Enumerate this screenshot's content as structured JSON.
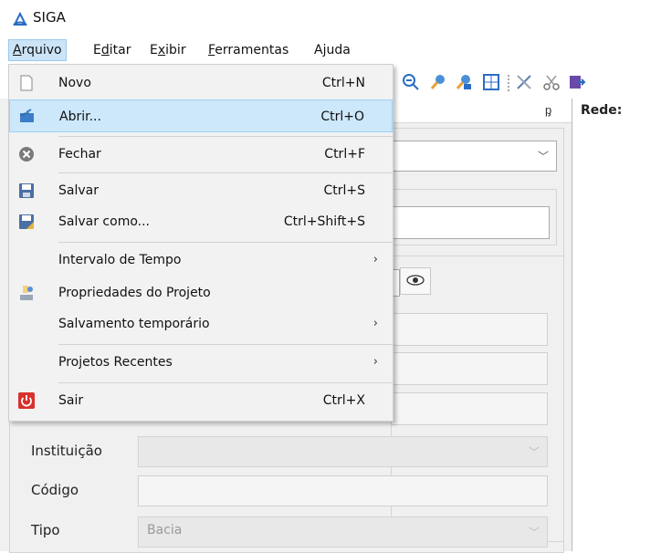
{
  "app": {
    "title": "SIGA"
  },
  "menubar": {
    "items": [
      {
        "label": "Arquivo",
        "key": "A",
        "rest": "rquivo"
      },
      {
        "label": "Editar",
        "key": "d",
        "pre": "E",
        "rest": "itar"
      },
      {
        "label": "Exibir",
        "key": "x",
        "pre": "E",
        "rest": "ibir"
      },
      {
        "label": "Ferramentas",
        "key": "F",
        "rest": "erramentas"
      },
      {
        "label": "Ajuda",
        "key": "j",
        "pre": "A",
        "rest": "uda"
      }
    ]
  },
  "panel": {
    "rede_label": "Rede:"
  },
  "form": {
    "instituicao_label": "Instituição",
    "codigo_label": "Código",
    "tipo_label": "Tipo",
    "tipo_value": "Bacia"
  },
  "file_menu": {
    "items": [
      {
        "label": "Novo",
        "shortcut": "Ctrl+N"
      },
      {
        "label": "Abrir...",
        "shortcut": "Ctrl+O"
      },
      {
        "label": "Fechar",
        "shortcut": "Ctrl+F"
      },
      {
        "label": "Salvar",
        "shortcut": "Ctrl+S"
      },
      {
        "label": "Salvar como...",
        "shortcut": "Ctrl+Shift+S"
      },
      {
        "label": "Intervalo de Tempo",
        "shortcut": ""
      },
      {
        "label": "Propriedades do Projeto",
        "shortcut": ""
      },
      {
        "label": "Salvamento temporário",
        "shortcut": ""
      },
      {
        "label": "Projetos Recentes",
        "shortcut": ""
      },
      {
        "label": "Sair",
        "shortcut": "Ctrl+X"
      }
    ]
  },
  "colors": {
    "menu_highlight": "#cde8fb",
    "menu_background": "#f2f2f2",
    "accent_blue": "#2b6cc4",
    "exit_red": "#d9302c"
  }
}
